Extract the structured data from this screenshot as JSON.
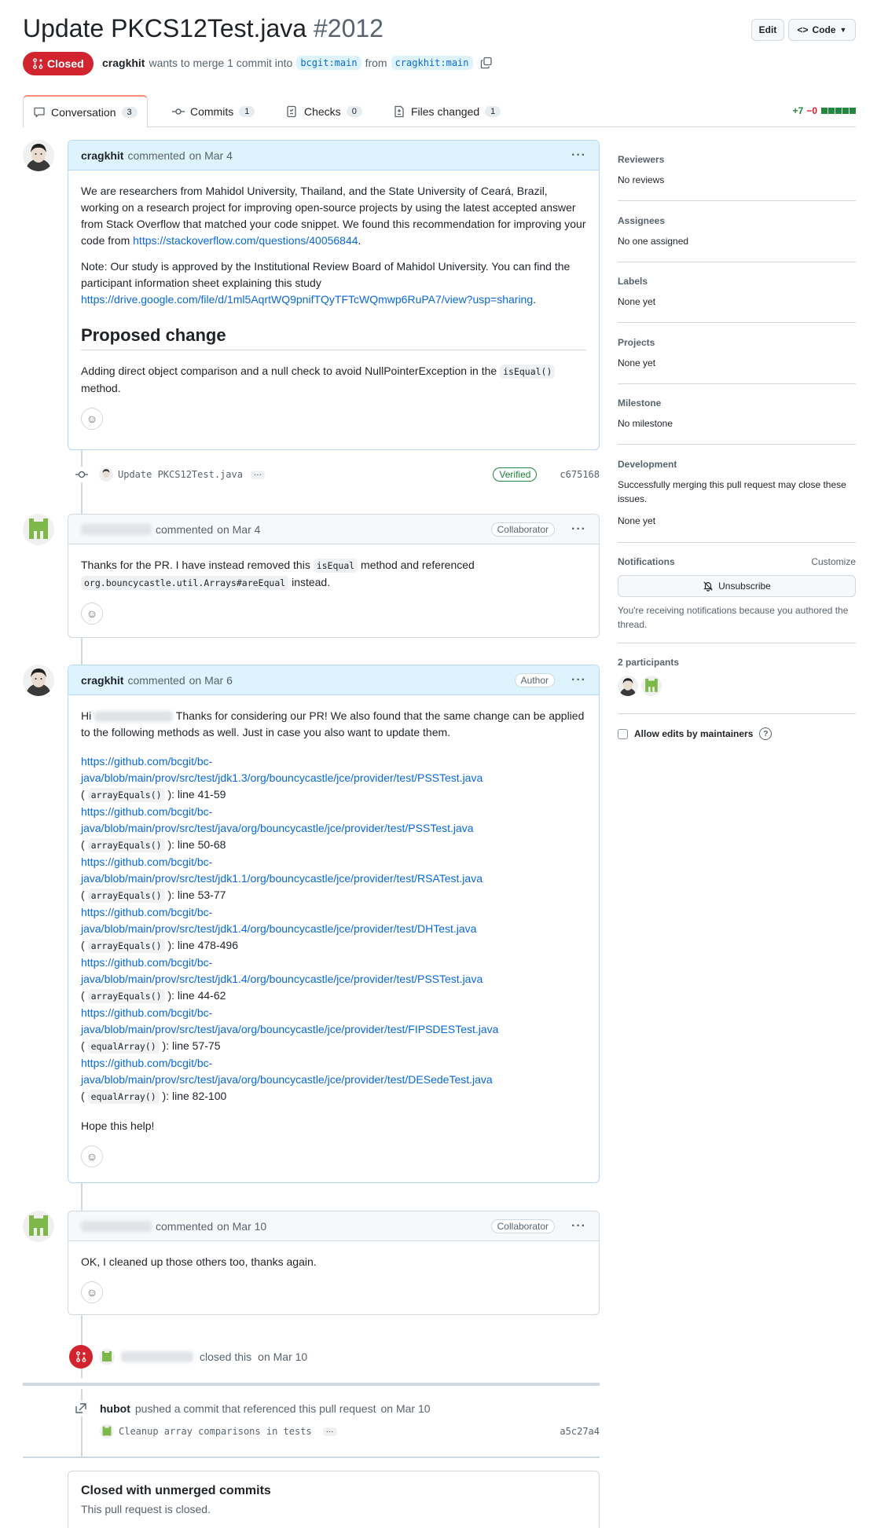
{
  "header": {
    "title": "Update PKCS12Test.java",
    "number": "#2012",
    "edit_label": "Edit",
    "code_label": "Code",
    "state": "Closed",
    "author": "cragkhit",
    "merge_text": "wants to merge 1 commit into",
    "base_branch": "bcgit:main",
    "from_text": "from",
    "head_branch": "cragkhit:main"
  },
  "tabs": [
    {
      "label": "Conversation",
      "count": "3"
    },
    {
      "label": "Commits",
      "count": "1"
    },
    {
      "label": "Checks",
      "count": "0"
    },
    {
      "label": "Files changed",
      "count": "1"
    }
  ],
  "diffstat": {
    "added": "+7",
    "removed": "−0"
  },
  "comment1": {
    "author": "cragkhit",
    "action": "commented",
    "date": "on Mar 4",
    "p1": "We are researchers from Mahidol University, Thailand, and the State University of Ceará, Brazil, working on a research project for improving open-source projects by using the latest accepted answer from Stack Overflow that matched your code snippet. We found this recommendation for improving your code from ",
    "p1_link": "https://stackoverflow.com/questions/40056844",
    "p2": "Note: Our study is approved by the Institutional Review Board of Mahidol University. You can find the participant information sheet explaining this study ",
    "p2_link": "https://drive.google.com/file/d/1ml5AqrtWQ9pnifTQyTFTcWQmwp6RuPA7/view?usp=sharing",
    "heading": "Proposed change",
    "p3a": "Adding direct object comparison and a null check to avoid NullPointerException in the ",
    "p3_code": "isEqual()",
    "p3b": "method."
  },
  "commit1": {
    "message": "Update PKCS12Test.java",
    "verified": "Verified",
    "sha": "c675168"
  },
  "comment2": {
    "action": "commented",
    "date": "on Mar 4",
    "badge": "Collaborator",
    "text_a": "Thanks for the PR. I have instead removed this ",
    "code1": "isEqual",
    "text_b": " method and referenced",
    "code2": "org.bouncycastle.util.Arrays#areEqual",
    "text_c": " instead."
  },
  "comment3": {
    "author": "cragkhit",
    "action": "commented",
    "date": "on Mar 6",
    "badge": "Author",
    "hi": "Hi ",
    "intro": " Thanks for considering our PR! We also found that the same change can be applied to the following methods as well. Just in case you also want to update them.",
    "links": [
      {
        "l1": "https://github.com/bcgit/bc-",
        "l2": "java/blob/main/prov/src/test/jdk1.3/org/bouncycastle/jce/provider/test/PSSTest.java",
        "code": "arrayEquals()",
        "lines": "line 41-59"
      },
      {
        "l1": "https://github.com/bcgit/bc-",
        "l2": "java/blob/main/prov/src/test/java/org/bouncycastle/jce/provider/test/PSSTest.java",
        "code": "arrayEquals()",
        "lines": "line 50-68"
      },
      {
        "l1": "https://github.com/bcgit/bc-",
        "l2": "java/blob/main/prov/src/test/jdk1.1/org/bouncycastle/jce/provider/test/RSATest.java",
        "code": "arrayEquals()",
        "lines": "line 53-77"
      },
      {
        "l1": "https://github.com/bcgit/bc-",
        "l2": "java/blob/main/prov/src/test/jdk1.4/org/bouncycastle/jce/provider/test/DHTest.java",
        "code": "arrayEquals()",
        "lines": "line 478-496"
      },
      {
        "l1": "https://github.com/bcgit/bc-",
        "l2": "java/blob/main/prov/src/test/jdk1.4/org/bouncycastle/jce/provider/test/PSSTest.java",
        "code": "arrayEquals()",
        "lines": "line 44-62"
      },
      {
        "l1": "https://github.com/bcgit/bc-",
        "l2": "java/blob/main/prov/src/test/java/org/bouncycastle/jce/provider/test/FIPSDESTest.java",
        "code": "equalArray()",
        "lines": "line 57-75"
      },
      {
        "l1": "https://github.com/bcgit/bc-",
        "l2": "java/blob/main/prov/src/test/java/org/bouncycastle/jce/provider/test/DESedeTest.java",
        "code": "equalArray()",
        "lines": "line 82-100"
      }
    ],
    "closing": "Hope this help!"
  },
  "comment4": {
    "action": "commented",
    "date": "on Mar 10",
    "badge": "Collaborator",
    "text": "OK, I cleaned up those others too, thanks again."
  },
  "closed_event": {
    "text": "closed this",
    "date": "on Mar 10"
  },
  "push_event": {
    "actor": "hubot",
    "text": "pushed a commit that referenced this pull request",
    "date": "on Mar 10",
    "commit_message": "Cleanup array comparisons in tests",
    "sha": "a5c27a4"
  },
  "closed_box": {
    "title": "Closed with unmerged commits",
    "subtitle": "This pull request is closed."
  },
  "sidebar": {
    "reviewers": {
      "label": "Reviewers",
      "value": "No reviews"
    },
    "assignees": {
      "label": "Assignees",
      "value": "No one assigned"
    },
    "labels": {
      "label": "Labels",
      "value": "None yet"
    },
    "projects": {
      "label": "Projects",
      "value": "None yet"
    },
    "milestone": {
      "label": "Milestone",
      "value": "No milestone"
    },
    "development": {
      "label": "Development",
      "text": "Successfully merging this pull request may close these issues.",
      "value": "None yet"
    },
    "notifications": {
      "label": "Notifications",
      "customize": "Customize",
      "button": "Unsubscribe",
      "text": "You're receiving notifications because you authored the thread."
    },
    "participants": {
      "label": "2 participants"
    },
    "allow_edits": "Allow edits by maintainers"
  },
  "colors": {
    "closed": "#d1242f",
    "link": "#0969da",
    "added": "#1f883d",
    "removed": "#d1242f",
    "own_header": "#ddf4ff"
  }
}
